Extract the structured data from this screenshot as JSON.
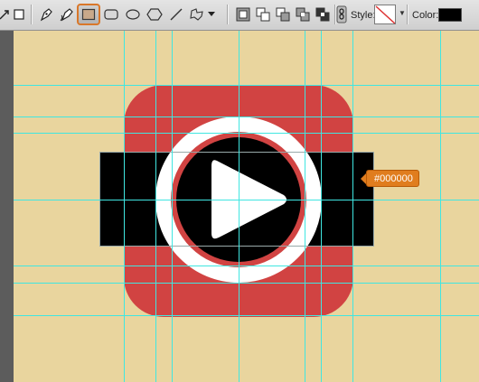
{
  "options_bar": {
    "tools": [
      {
        "name": "path-selection-icon"
      },
      {
        "name": "rectangle-mode-icon"
      },
      {
        "name": "pen-tool-icon"
      },
      {
        "name": "freeform-pen-icon"
      },
      {
        "name": "rectangle-tool-icon",
        "selected": true
      },
      {
        "name": "rounded-rectangle-tool-icon"
      },
      {
        "name": "ellipse-tool-icon"
      },
      {
        "name": "polygon-tool-icon"
      },
      {
        "name": "line-tool-icon"
      },
      {
        "name": "custom-shape-tool-icon"
      },
      {
        "name": "custom-shape-dropdown-icon"
      }
    ],
    "path_ops": [
      "create-new-shape-layer-icon",
      "add-to-shape-area-icon",
      "subtract-from-shape-area-icon",
      "intersect-shape-areas-icon",
      "exclude-overlapping-icon"
    ],
    "link_icon": "link-layer-style-icon",
    "style_label": "Style:",
    "color_label": "Color:",
    "color_value": "#000000"
  },
  "canvas": {
    "background": "#e9d59e",
    "icon_red": "#d14342",
    "ring_white": "#ffffff",
    "bar_black": "#000000",
    "play_white": "#ffffff",
    "guide_color": "#40e6e1"
  },
  "tooltip": {
    "text": "#000000",
    "color": "#e07d1e"
  }
}
